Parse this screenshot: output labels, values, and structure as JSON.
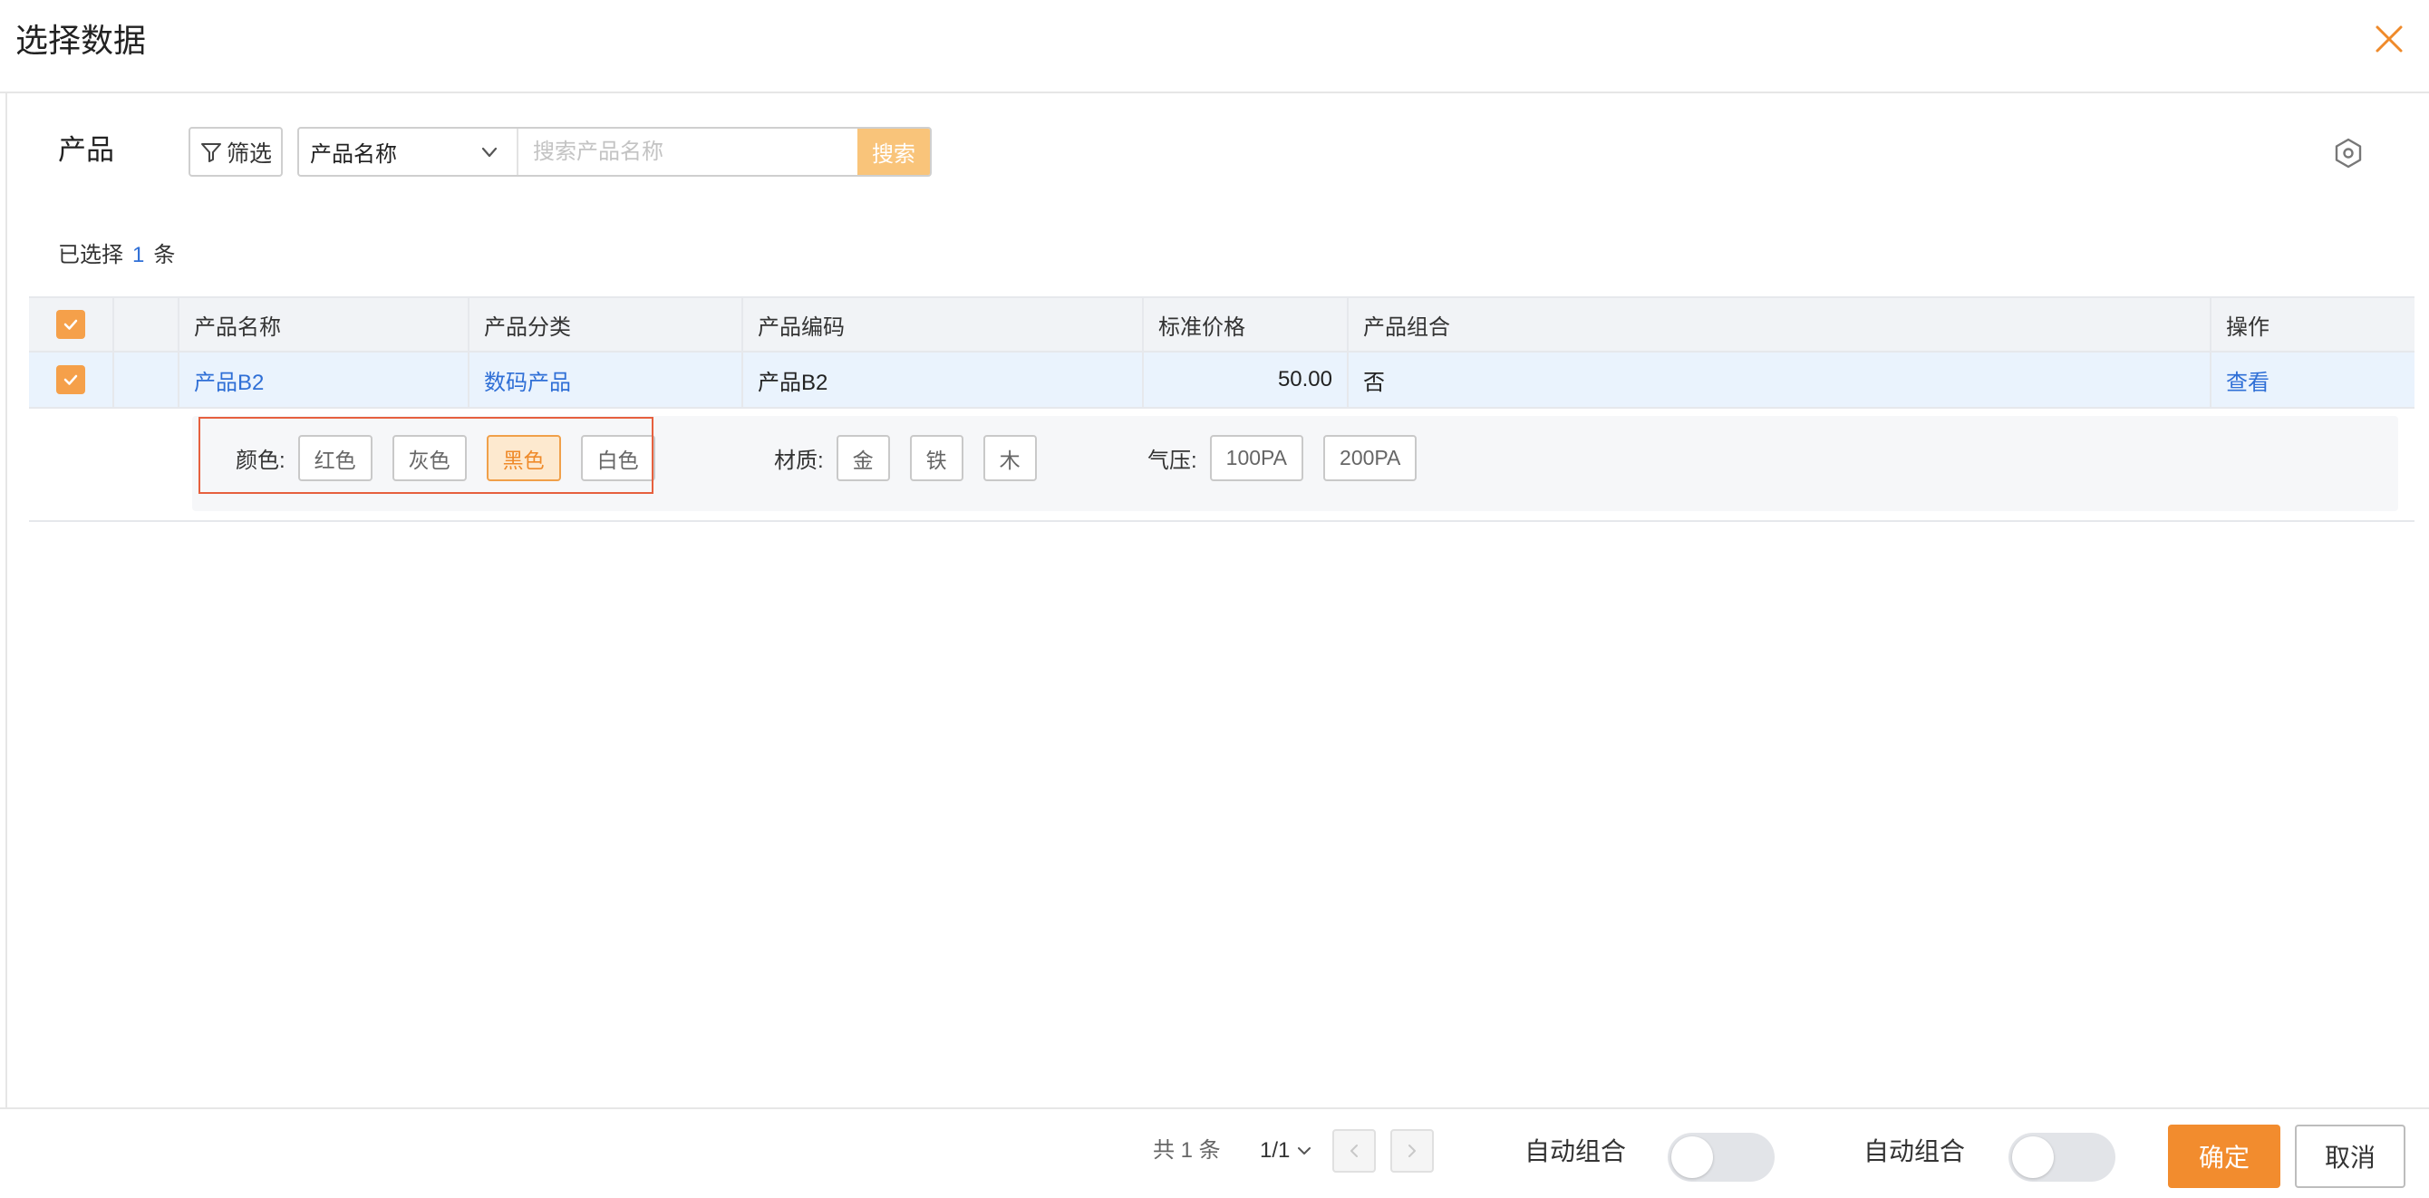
{
  "dialog": {
    "title": "选择数据"
  },
  "toolbar": {
    "object_label": "产品",
    "filter_label": "筛选",
    "field_select_value": "产品名称",
    "search_placeholder": "搜索产品名称",
    "search_button": "搜索"
  },
  "selection": {
    "prefix": "已选择",
    "count": "1",
    "suffix": "条"
  },
  "table": {
    "columns": [
      "产品名称",
      "产品分类",
      "产品编码",
      "标准价格",
      "产品组合",
      "操作"
    ],
    "rows": [
      {
        "checked": true,
        "name": "产品B2",
        "category": "数码产品",
        "code": "产品B2",
        "price": "50.00",
        "combo": "否",
        "action": "查看"
      }
    ]
  },
  "attributes": [
    {
      "label": "颜色:",
      "options": [
        "红色",
        "灰色",
        "黑色",
        "白色"
      ],
      "selected": "黑色"
    },
    {
      "label": "材质:",
      "options": [
        "金",
        "铁",
        "木"
      ],
      "selected": null
    },
    {
      "label": "气压:",
      "options": [
        "100PA",
        "200PA"
      ],
      "selected": null
    }
  ],
  "footer": {
    "total_text": "共 1 条",
    "page_text": "1/1",
    "toggle1_label": "自动组合",
    "toggle2_label": "自动组合",
    "confirm_label": "确定",
    "cancel_label": "取消"
  },
  "colors": {
    "accent": "#f28c2e",
    "link": "#2f6fd6",
    "highlight": "#e6603e"
  }
}
